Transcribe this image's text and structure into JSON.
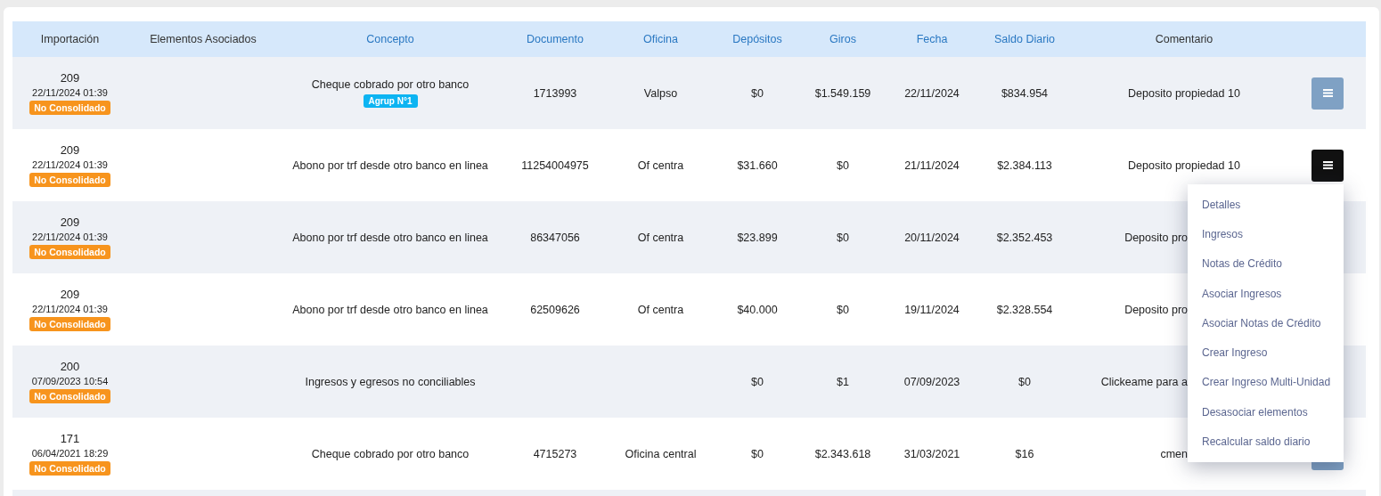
{
  "table": {
    "columns": [
      {
        "label": "Importación",
        "sortable": false
      },
      {
        "label": "Elementos Asociados",
        "sortable": false
      },
      {
        "label": "Concepto",
        "sortable": true
      },
      {
        "label": "Documento",
        "sortable": true
      },
      {
        "label": "Oficina",
        "sortable": true
      },
      {
        "label": "Depósitos",
        "sortable": true
      },
      {
        "label": "Giros",
        "sortable": true
      },
      {
        "label": "Fecha",
        "sortable": true
      },
      {
        "label": "Saldo Diario",
        "sortable": true
      },
      {
        "label": "Comentario",
        "sortable": false
      }
    ],
    "rows": [
      {
        "import_id": "209",
        "import_date": "22/11/2024 01:39",
        "status": "No Consolidado",
        "concept": "Cheque cobrado por otro banco",
        "group_tag": "Agrup N°1",
        "document": "1713993",
        "office": "Valpso",
        "deposits": "$0",
        "withdrawals": "$1.549.159",
        "date": "22/11/2024",
        "daily_balance": "$834.954",
        "comment": "Deposito propiedad 10",
        "button": {
          "active": false
        }
      },
      {
        "import_id": "209",
        "import_date": "22/11/2024 01:39",
        "status": "No Consolidado",
        "concept": "Abono por trf desde otro banco en linea",
        "document": "11254004975",
        "office": "Of centra",
        "deposits": "$31.660",
        "withdrawals": "$0",
        "date": "21/11/2024",
        "daily_balance": "$2.384.113",
        "comment": "Deposito propiedad 10",
        "button": {
          "active": true
        }
      },
      {
        "import_id": "209",
        "import_date": "22/11/2024 01:39",
        "status": "No Consolidado",
        "concept": "Abono por trf desde otro banco en linea",
        "document": "86347056",
        "office": "Of centra",
        "deposits": "$23.899",
        "withdrawals": "$0",
        "date": "20/11/2024",
        "daily_balance": "$2.352.453",
        "comment": "Deposito pro"
      },
      {
        "import_id": "209",
        "import_date": "22/11/2024 01:39",
        "status": "No Consolidado",
        "concept": "Abono por trf desde otro banco en linea",
        "document": "62509626",
        "office": "Of centra",
        "deposits": "$40.000",
        "withdrawals": "$0",
        "date": "19/11/2024",
        "daily_balance": "$2.328.554",
        "comment": "Deposito pro"
      },
      {
        "import_id": "200",
        "import_date": "07/09/2023 10:54",
        "status": "No Consolidado",
        "concept": "Ingresos y egresos no conciliables",
        "deposits": "$0",
        "withdrawals": "$1",
        "date": "07/09/2023",
        "daily_balance": "$0",
        "comment": "Clickeame para a"
      },
      {
        "import_id": "171",
        "import_date": "06/04/2021 18:29",
        "status": "No Consolidado",
        "concept": "Cheque cobrado por otro banco",
        "document": "4715273",
        "office": "Oficina central",
        "deposits": "$0",
        "withdrawals": "$2.343.618",
        "date": "31/03/2021",
        "daily_balance": "$16",
        "comment": "cmen",
        "button": {
          "active": false
        }
      }
    ]
  },
  "menu": {
    "items": [
      "Detalles",
      "Ingresos",
      "Notas de Crédito",
      "Asociar Ingresos",
      "Asociar Notas de Crédito",
      "Crear Ingreso",
      "Crear Ingreso Multi-Unidad",
      "Desasociar elementos",
      "Recalcular saldo diario"
    ]
  }
}
